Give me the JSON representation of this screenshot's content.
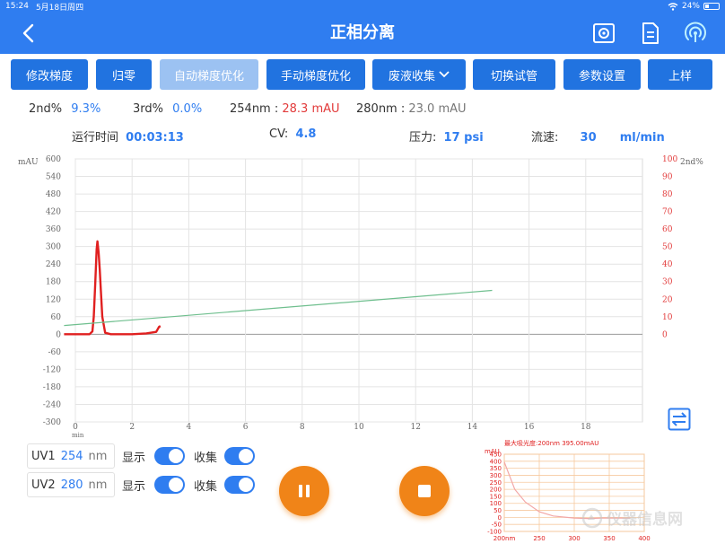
{
  "status": {
    "time": "15:24",
    "date": "5月18日周四",
    "battery": "24%"
  },
  "nav": {
    "title": "正相分离"
  },
  "toolbar": {
    "modify_gradient": "修改梯度",
    "zero": "归零",
    "auto_gradient": "自动梯度优化",
    "manual_gradient": "手动梯度优化",
    "waste_collect": "废液收集",
    "switch_tube": "切换试管",
    "params": "参数设置",
    "load_sample": "上样"
  },
  "info": {
    "second_label": "2nd%",
    "second_value": "9.3%",
    "third_label": "3rd%",
    "third_value": "0.0%",
    "uv254_label": "254nm :",
    "uv254_value": "28.3 mAU",
    "uv280_label": "280nm :",
    "uv280_value": "23.0 mAU",
    "runtime_label": "运行时间",
    "runtime_value": "00:03:13",
    "cv_label": "CV:",
    "cv_value": "4.8",
    "pressure_label": "压力:",
    "pressure_value": "17 psi",
    "flow_label": "流速:",
    "flow_value": "30",
    "flow_unit": "ml/min"
  },
  "chart_data": {
    "type": "line",
    "ylabel_left": "mAU",
    "ylabel_right": "2nd%",
    "xlabel": "min",
    "xlim": [
      0,
      20
    ],
    "ylim_left": [
      -300,
      600
    ],
    "ylim_right": [
      0,
      100
    ],
    "x_ticks": [
      "0",
      "2",
      "4",
      "6",
      "8",
      "10",
      "12",
      "14",
      "16",
      "18"
    ],
    "y_left_ticks": [
      "600",
      "540",
      "480",
      "420",
      "360",
      "300",
      "240",
      "180",
      "120",
      "60",
      "0",
      "-60",
      "-120",
      "-180",
      "-240",
      "-300"
    ],
    "y_right_ticks": [
      "100",
      "90",
      "80",
      "70",
      "60",
      "50",
      "40",
      "30",
      "20",
      "10",
      "0"
    ],
    "grid": true,
    "series": [
      {
        "axis": "left",
        "color": "#e02020",
        "x": [
          -0.4,
          0.5,
          0.6,
          0.65,
          0.7,
          0.75,
          0.78,
          0.82,
          0.86,
          0.9,
          0.95,
          1.05,
          1.25,
          1.6,
          2.0,
          2.5,
          2.85,
          2.95,
          3.0
        ],
        "y": [
          0,
          0,
          10,
          60,
          170,
          290,
          318,
          280,
          220,
          150,
          60,
          5,
          0,
          0,
          0,
          3,
          8,
          25,
          28
        ]
      },
      {
        "axis": "right",
        "color": "#6fbf8e",
        "x": [
          -0.4,
          14.7
        ],
        "y": [
          5,
          25
        ]
      }
    ]
  },
  "uv": [
    {
      "name": "UV1",
      "wavelength": "254",
      "unit": "nm",
      "show_label": "显示",
      "collect_label": "收集"
    },
    {
      "name": "UV2",
      "wavelength": "280",
      "unit": "nm",
      "show_label": "显示",
      "collect_label": "收集"
    }
  ],
  "spectrum": {
    "title": "最大吸光度:200nm 395.00mAU",
    "ylabel": "mAU",
    "y_ticks": [
      "450",
      "400",
      "350",
      "300",
      "250",
      "200",
      "150",
      "100",
      "50",
      "0",
      "-50",
      "-100"
    ],
    "x_ticks": [
      "200nm",
      "250",
      "300",
      "350",
      "400"
    ],
    "x": [
      200,
      205,
      215,
      230,
      250,
      270,
      290,
      300,
      320,
      340,
      360,
      380
    ],
    "y": [
      395,
      330,
      200,
      110,
      40,
      10,
      0,
      -5,
      -8,
      -5,
      -5,
      -5
    ]
  },
  "colors": {
    "primary": "#2f7df0",
    "button": "#2173e0",
    "accent": "#f08418",
    "red": "#e23a3a"
  },
  "watermark": "仪器信息网"
}
